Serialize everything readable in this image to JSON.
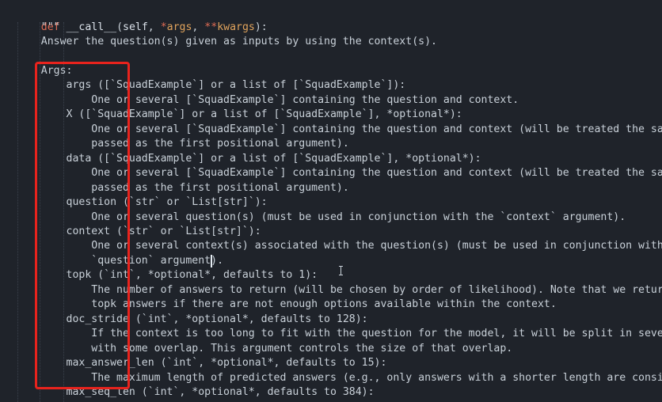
{
  "colors": {
    "background": "#1f232a",
    "keyword": "#e06c54",
    "parameter": "#e0a35c",
    "text": "#c9d1d9",
    "highlight_box": "#e8231d"
  },
  "signature": {
    "keyword": "def",
    "name": "__call__",
    "open_paren": "(",
    "self": "self",
    "comma1": ", ",
    "star": "*",
    "args": "args",
    "comma2": ", ",
    "double_star": "**",
    "kwargs": "kwargs",
    "close": "):"
  },
  "docstring_lines": [
    "    \"\"\"",
    "    Answer the question(s) given as inputs by using the context(s).",
    "",
    "    Args:",
    "        args ([`SquadExample`] or a list of [`SquadExample`]):",
    "            One or several [`SquadExample`] containing the question and context.",
    "        X ([`SquadExample`] or a list of [`SquadExample`], *optional*):",
    "            One or several [`SquadExample`] containing the question and context (will be treated the same way",
    "            passed as the first positional argument).",
    "        data ([`SquadExample`] or a list of [`SquadExample`], *optional*):",
    "            One or several [`SquadExample`] containing the question and context (will be treated the same way",
    "            passed as the first positional argument).",
    "        question (`str` or `List[str]`):",
    "            One or several question(s) (must be used in conjunction with the `context` argument).",
    "        context (`str` or `List[str]`):",
    "            One or several context(s) associated with the question(s) (must be used in conjunction with the",
    "            `question` argument).",
    "        topk (`int`, *optional*, defaults to 1):",
    "            The number of answers to return (will be chosen by order of likelihood). Note that we return less",
    "            topk answers if there are not enough options available within the context.",
    "        doc_stride (`int`, *optional*, defaults to 128):",
    "            If the context is too long to fit with the question for the model, it will be split in several chu",
    "            with some overlap. This argument controls the size of that overlap.",
    "        max_answer_len (`int`, *optional*, defaults to 15):",
    "            The maximum length of predicted answers (e.g., only answers with a shorter length are considered).",
    "        max_seq_len (`int`, *optional*, defaults to 384):"
  ]
}
